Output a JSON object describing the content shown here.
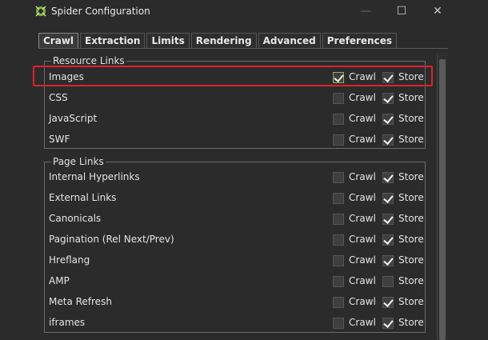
{
  "window": {
    "title": "Spider Configuration",
    "controls": {
      "minimize": "—",
      "maximize": "☐",
      "close": "✕"
    }
  },
  "tabs": [
    {
      "label": "Crawl",
      "active": true
    },
    {
      "label": "Extraction",
      "active": false
    },
    {
      "label": "Limits",
      "active": false
    },
    {
      "label": "Rendering",
      "active": false
    },
    {
      "label": "Advanced",
      "active": false
    },
    {
      "label": "Preferences",
      "active": false
    }
  ],
  "option_labels": {
    "crawl": "Crawl",
    "store": "Store"
  },
  "groups": [
    {
      "title": "Resource Links",
      "rows": [
        {
          "label": "Images",
          "crawl": true,
          "store": true,
          "highlighted": true
        },
        {
          "label": "CSS",
          "crawl": false,
          "store": true
        },
        {
          "label": "JavaScript",
          "crawl": false,
          "store": true
        },
        {
          "label": "SWF",
          "crawl": false,
          "store": true
        }
      ]
    },
    {
      "title": "Page Links",
      "rows": [
        {
          "label": "Internal Hyperlinks",
          "crawl": false,
          "store": true
        },
        {
          "label": "External Links",
          "crawl": false,
          "store": true
        },
        {
          "label": "Canonicals",
          "crawl": false,
          "store": true
        },
        {
          "label": "Pagination (Rel Next/Prev)",
          "crawl": false,
          "store": true
        },
        {
          "label": "Hreflang",
          "crawl": false,
          "store": true
        },
        {
          "label": "AMP",
          "crawl": false,
          "store": false
        },
        {
          "label": "Meta Refresh",
          "crawl": false,
          "store": true
        },
        {
          "label": "iframes",
          "crawl": false,
          "store": true
        }
      ]
    }
  ],
  "colors": {
    "highlight_border": "#e0202a",
    "background": "#2b2b2b"
  }
}
